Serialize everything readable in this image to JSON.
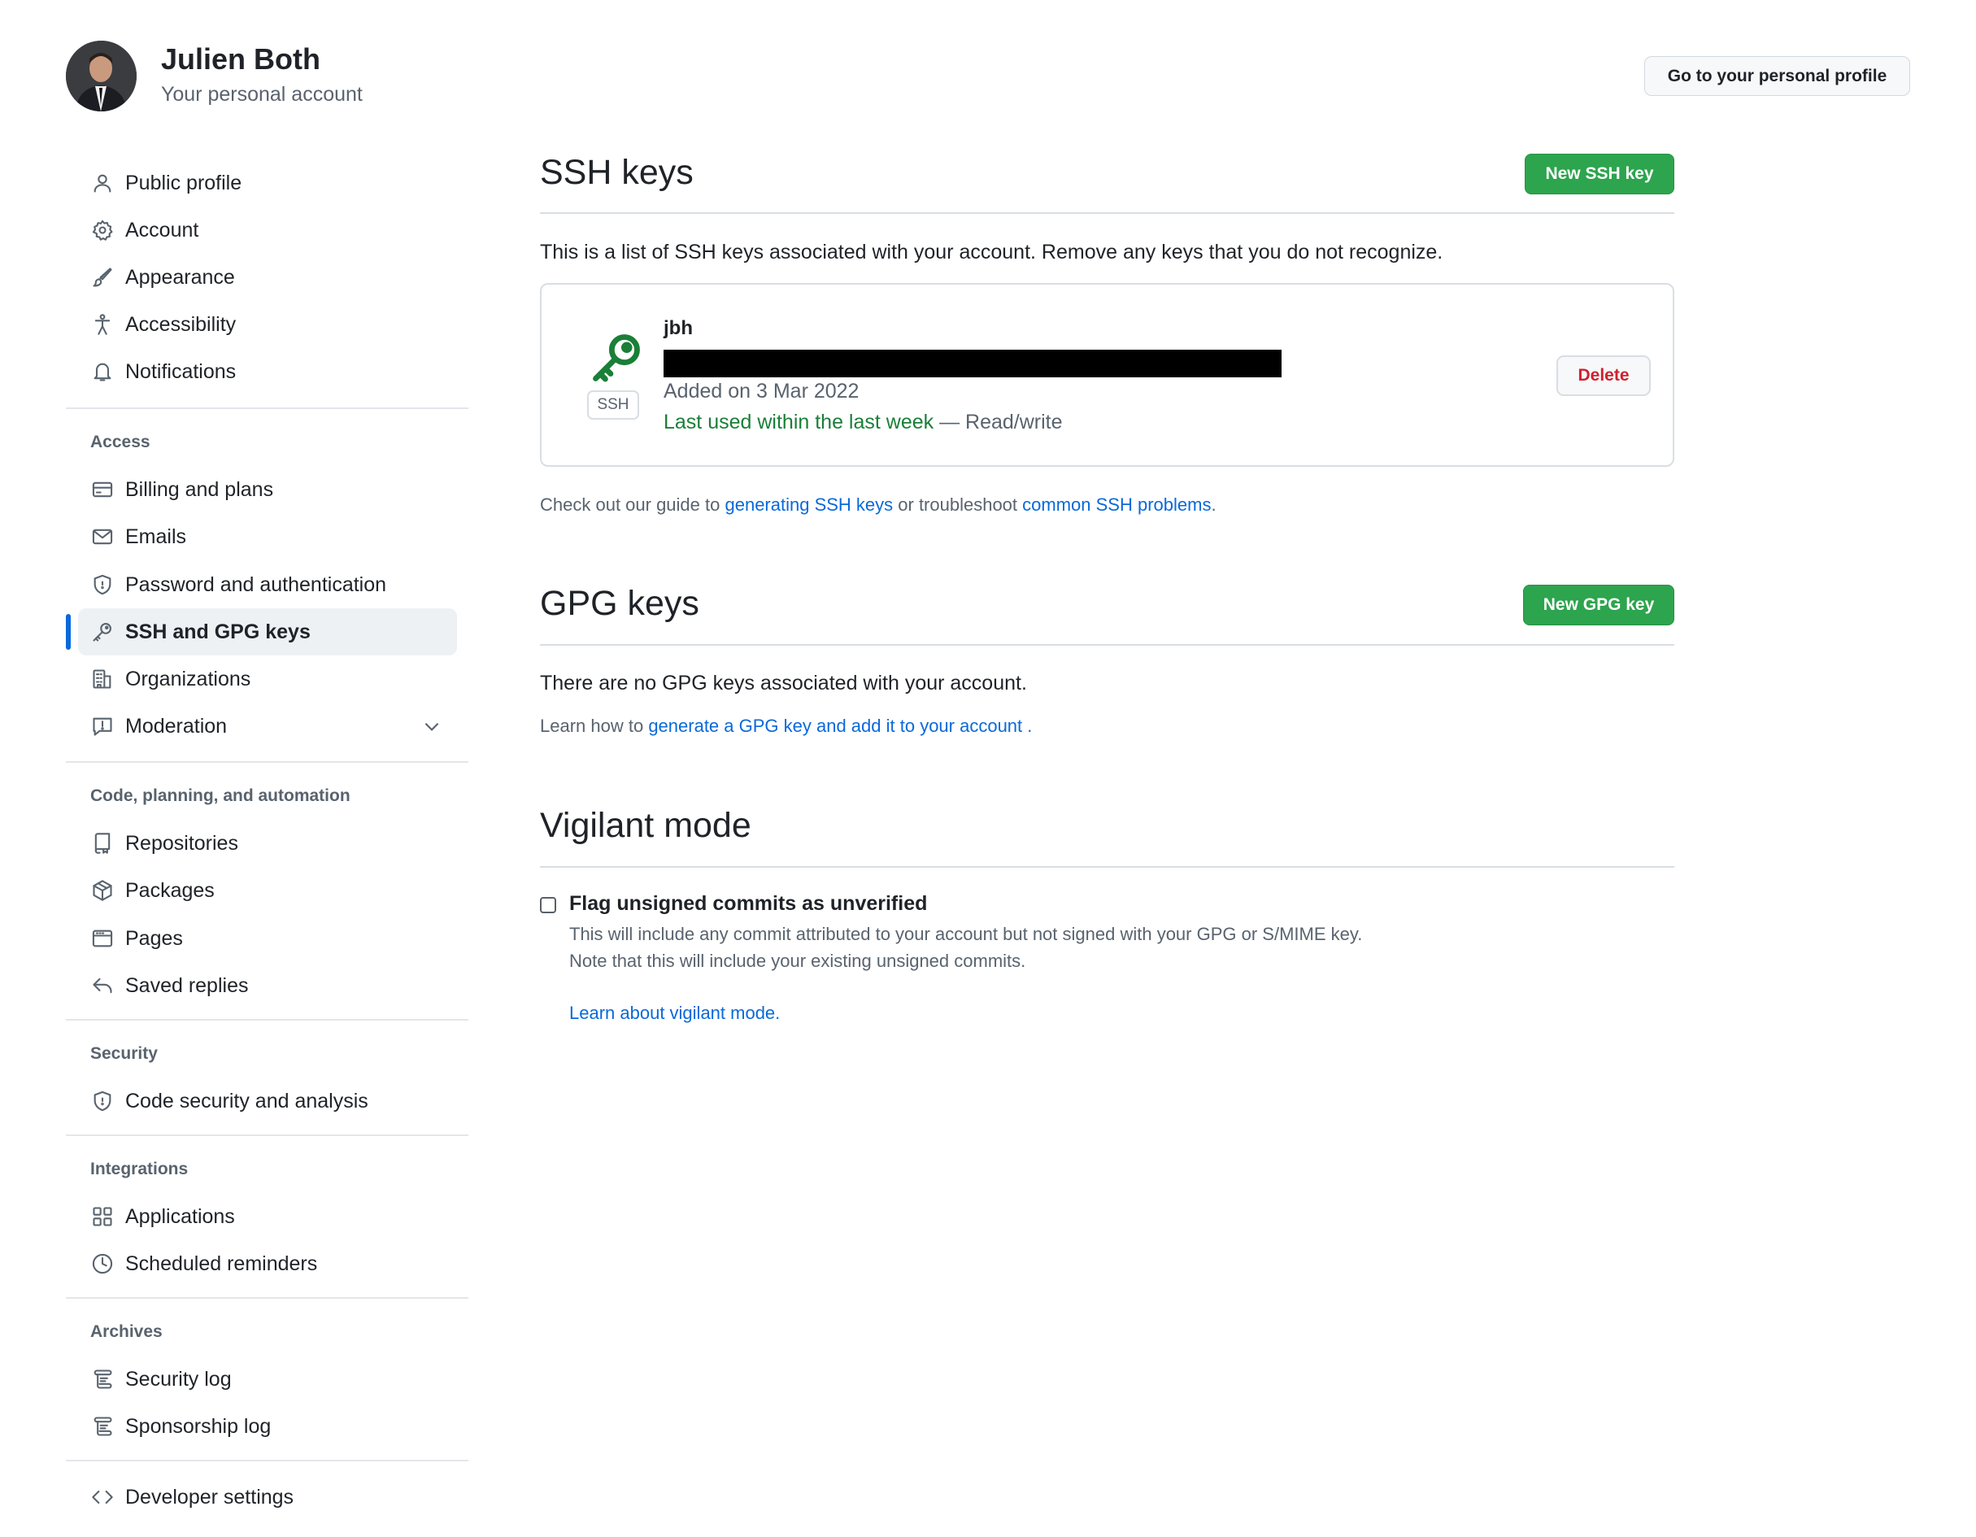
{
  "user": {
    "name": "Julien Both",
    "subtitle": "Your personal account",
    "profile_button": "Go to your personal profile"
  },
  "sidebar": {
    "top_items": [
      {
        "label": "Public profile",
        "icon": "person-icon"
      },
      {
        "label": "Account",
        "icon": "gear-icon"
      },
      {
        "label": "Appearance",
        "icon": "paintbrush-icon"
      },
      {
        "label": "Accessibility",
        "icon": "accessibility-icon"
      },
      {
        "label": "Notifications",
        "icon": "bell-icon"
      }
    ],
    "access": {
      "heading": "Access",
      "items": [
        {
          "label": "Billing and plans",
          "icon": "credit-card-icon"
        },
        {
          "label": "Emails",
          "icon": "mail-icon"
        },
        {
          "label": "Password and authentication",
          "icon": "shield-icon"
        },
        {
          "label": "SSH and GPG keys",
          "icon": "key-icon",
          "active": true
        },
        {
          "label": "Organizations",
          "icon": "organization-icon"
        },
        {
          "label": "Moderation",
          "icon": "report-icon"
        }
      ]
    },
    "code": {
      "heading": "Code, planning, and automation",
      "items": [
        {
          "label": "Repositories",
          "icon": "repo-icon"
        },
        {
          "label": "Packages",
          "icon": "package-icon"
        },
        {
          "label": "Pages",
          "icon": "browser-icon"
        },
        {
          "label": "Saved replies",
          "icon": "reply-icon"
        }
      ]
    },
    "security": {
      "heading": "Security",
      "items": [
        {
          "label": "Code security and analysis",
          "icon": "shield-icon"
        }
      ]
    },
    "integrations": {
      "heading": "Integrations",
      "items": [
        {
          "label": "Applications",
          "icon": "apps-icon"
        },
        {
          "label": "Scheduled reminders",
          "icon": "clock-icon"
        }
      ]
    },
    "archives": {
      "heading": "Archives",
      "items": [
        {
          "label": "Security log",
          "icon": "log-icon"
        },
        {
          "label": "Sponsorship log",
          "icon": "log-icon"
        }
      ]
    },
    "developer": {
      "label": "Developer settings",
      "icon": "code-icon"
    }
  },
  "ssh": {
    "title": "SSH keys",
    "new_button": "New SSH key",
    "description": "This is a list of SSH keys associated with your account. Remove any keys that you do not recognize.",
    "key": {
      "name": "jbh",
      "badge": "SSH",
      "added": "Added on 3 Mar 2022",
      "last_used": "Last used within the last week",
      "access": " — Read/write",
      "delete_button": "Delete"
    },
    "guide": {
      "prefix": "Check out our guide to ",
      "link1": "generating SSH keys",
      "middle": " or troubleshoot ",
      "link2": "common SSH problems",
      "suffix": "."
    }
  },
  "gpg": {
    "title": "GPG keys",
    "new_button": "New GPG key",
    "empty": "There are no GPG keys associated with your account.",
    "learn": {
      "prefix": "Learn how to ",
      "link": "generate a GPG key and add it to your account",
      "suffix": " ."
    }
  },
  "vigilant": {
    "title": "Vigilant mode",
    "checkbox_label": "Flag unsigned commits as unverified",
    "checked": false,
    "desc1": "This will include any commit attributed to your account but not signed with your GPG or S/MIME key.",
    "desc2": "Note that this will include your existing unsigned commits.",
    "learn_link": "Learn about vigilant mode."
  }
}
